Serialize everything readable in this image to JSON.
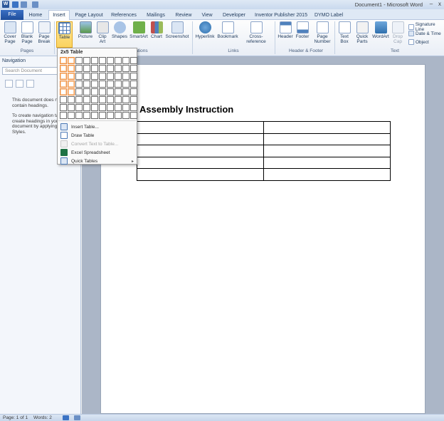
{
  "window": {
    "title": "Document1 - Microsoft Word",
    "app_icon_letter": "W",
    "minimize": "–",
    "close": "x"
  },
  "tabs": [
    {
      "label": "File"
    },
    {
      "label": "Home"
    },
    {
      "label": "Insert"
    },
    {
      "label": "Page Layout"
    },
    {
      "label": "References"
    },
    {
      "label": "Mailings"
    },
    {
      "label": "Review"
    },
    {
      "label": "View"
    },
    {
      "label": "Developer"
    },
    {
      "label": "Inventor Publisher 2015"
    },
    {
      "label": "DYMO Label"
    }
  ],
  "ribbon": {
    "pages": {
      "cover_page": "Cover Page",
      "blank_page": "Blank Page",
      "page_break": "Page Break",
      "group_label": "Pages"
    },
    "tables": {
      "table": "Table"
    },
    "illustrations": {
      "picture": "Picture",
      "clip_art": "Clip Art",
      "shapes": "Shapes",
      "smartart": "SmartArt",
      "chart": "Chart",
      "screenshot": "Screenshot",
      "group_label_partial": "ations"
    },
    "links": {
      "hyperlink": "Hyperlink",
      "bookmark": "Bookmark",
      "cross_reference": "Cross-reference",
      "group_label": "Links"
    },
    "header_footer": {
      "header": "Header",
      "footer": "Footer",
      "page_number": "Page Number",
      "group_label": "Header & Footer"
    },
    "text": {
      "text_box": "Text Box",
      "quick_parts": "Quick Parts",
      "wordart": "WordArt",
      "drop_cap": "Drop Cap",
      "signature_line": "Signature Line",
      "date_time": "Date & Time",
      "object": "Object",
      "group_label": "Text"
    }
  },
  "navigation": {
    "title": "Navigation",
    "search_placeholder": "Search Document",
    "message1": "This document does not contain headings.",
    "message2": "To create navigation tabs, create headings in your document by applying Heading Styles."
  },
  "table_menu": {
    "header": "2x5 Table",
    "grid_cols": 10,
    "grid_rows": 8,
    "selected_cols": 2,
    "selected_rows": 5,
    "items": [
      {
        "label": "Insert Table...",
        "disabled": false
      },
      {
        "label": "Draw Table",
        "disabled": false
      },
      {
        "label": "Convert Text to Table...",
        "disabled": true
      },
      {
        "label": "Excel Spreadsheet",
        "disabled": false
      },
      {
        "label": "Quick Tables",
        "disabled": false,
        "submenu_arrow": "▸"
      }
    ]
  },
  "document": {
    "heading": "Assembly Instruction",
    "table_rows": 5,
    "table_cols": 2
  },
  "status": {
    "page": "Page: 1 of 1",
    "words": "Words: 2"
  },
  "colors": {
    "accent": "#2b579a",
    "selection": "#ee8b3a",
    "ribbon_highlight": "#fbd35f"
  }
}
